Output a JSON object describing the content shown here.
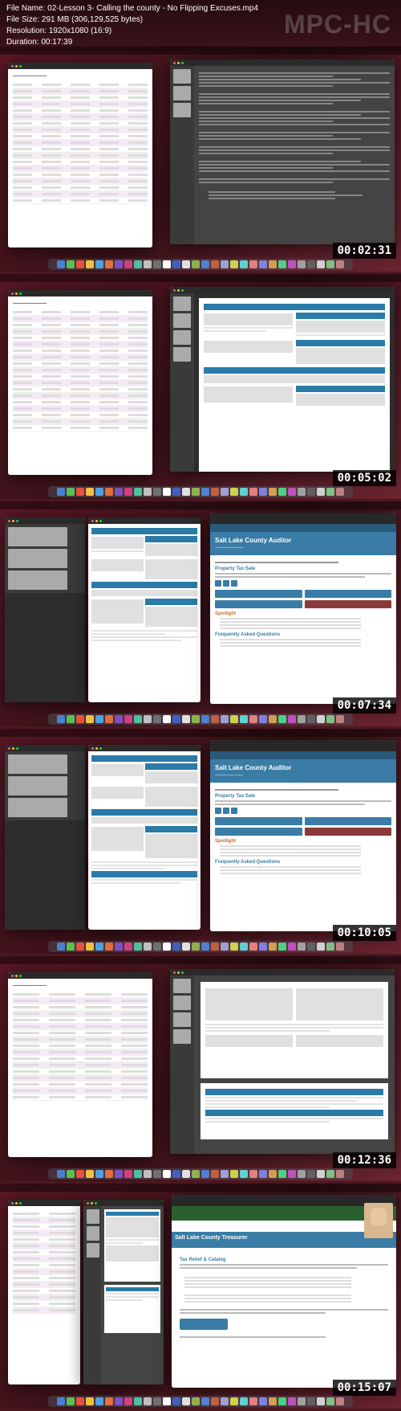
{
  "watermark": "MPC-HC",
  "file_info": {
    "name_label": "File Name:",
    "name": "02-Lesson 3- Calling the county - No Flipping Excuses.mp4",
    "size_label": "File Size:",
    "size": "291 MB (306,129,525 bytes)",
    "res_label": "Resolution:",
    "res": "1920x1080 (16:9)",
    "dur_label": "Duration:",
    "dur": "00:17:39"
  },
  "frames": [
    {
      "ts": "00:02:31"
    },
    {
      "ts": "00:05:02"
    },
    {
      "ts": "00:07:34"
    },
    {
      "ts": "00:10:05"
    },
    {
      "ts": "00:12:36"
    },
    {
      "ts": "00:15:07"
    }
  ],
  "county_site": {
    "title": "Salt Lake County Auditor",
    "h1": "Property Tax Sale",
    "h2": "Spotlight",
    "h3": "Frequently Asked Questions"
  },
  "treasurer": {
    "title": "Salt Lake County Treasurer",
    "section": "Tax Relief & Catalog"
  },
  "dock_colors": [
    "#4a80d0",
    "#5ac050",
    "#e85040",
    "#f0c040",
    "#50a0e0",
    "#e07040",
    "#8050c0",
    "#d04080",
    "#50c0a0",
    "#c0c0c0",
    "#707070",
    "#ffffff",
    "#4060c0",
    "#e0e0e0",
    "#90b050",
    "#5080d0",
    "#c06040",
    "#a0a0d0",
    "#d0d050",
    "#60d0d0",
    "#e08080",
    "#8080e0",
    "#d0a050",
    "#50d080",
    "#c050c0",
    "#a0a0a0",
    "#606060",
    "#d0d0d0",
    "#80c080",
    "#c08080"
  ]
}
